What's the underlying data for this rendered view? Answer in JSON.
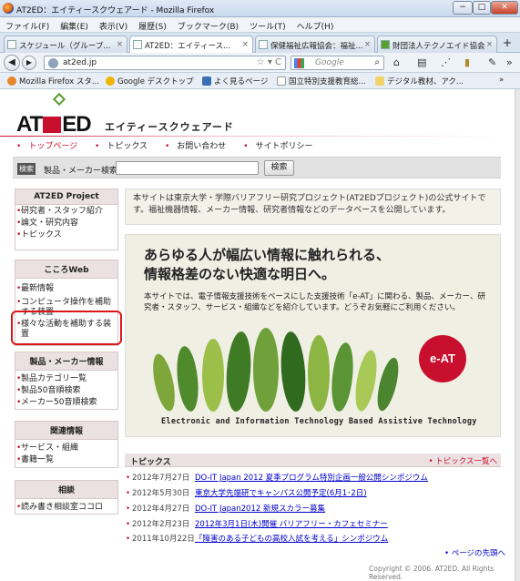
{
  "window": {
    "title": "AT2ED：エイティースクウェアード - Mozilla Firefox",
    "min": "−",
    "max": "□",
    "close": "✕"
  },
  "menu": [
    "ファイル(F)",
    "編集(E)",
    "表示(V)",
    "履歴(S)",
    "ブックマーク(B)",
    "ツール(T)",
    "ヘルプ(H)"
  ],
  "tabs": [
    {
      "label": "スケジュール（グループ..."
    },
    {
      "label": "AT2ED：エイティース..."
    },
    {
      "label": "保健福祉広報協会：福祉..."
    },
    {
      "label": "財団法人テクノエイド協会"
    }
  ],
  "new_tab": "+",
  "nav": {
    "url": "at2ed.jp",
    "search_placeholder": "Google"
  },
  "bookmarks": [
    "Mozilla Firefox スタ...",
    "Google デスクトップ",
    "よく見るページ",
    "国立特別支援教育総...",
    "デジタル教材、アク..."
  ],
  "site": {
    "logo_text_a": "AT",
    "logo_text_b": "ED",
    "logo_sub": "エイティースクウェアード",
    "topnav": [
      "トップページ",
      "トピックス",
      "お問い合わせ",
      "サイトポリシー"
    ],
    "search_label": "検索",
    "search_text": "製品・メーカー検索",
    "search_button": "検索"
  },
  "sidebar": [
    {
      "heading": "AT2ED Project",
      "items": [
        "研究者・スタッフ紹介",
        "論文・研究内容",
        "トピックス"
      ]
    },
    {
      "heading": "こころWeb",
      "items": [
        "最新情報",
        "コンピュータ操作を補助する装置",
        "様々な活動を補助する装置"
      ]
    },
    {
      "heading": "製品・メーカー情報",
      "items": [
        "製品カテゴリ一覧",
        "製品50音順検索",
        "メーカー50音順検索"
      ]
    },
    {
      "heading": "関連情報",
      "items": [
        "サービス・組織",
        "書籍一覧"
      ]
    },
    {
      "heading": "相談",
      "items": [
        "読み書き相談室ココロ"
      ]
    }
  ],
  "intro": "本サイトは東京大学・学際バリアフリー研究プロジェクト(AT2EDプロジェクト)の公式サイトです。福祉機器情報、メーカー情報、研究者情報などのデータベースを公開しています。",
  "hero": {
    "headline1": "あらゆる人が幅広い情報に触れられる、",
    "headline2": "情報格差のない快適な明日へ。",
    "body": "本サイトでは、電子情報支援技術をベースにした支援技術「e-AT」に関わる、製品、メーカー、研究者・スタッフ、サービス・組織などを紹介しています。どうぞお気軽にご利用ください。",
    "badge": "e-AT",
    "caption": "Electronic and Information Technology Based Assistive Technology"
  },
  "topics": {
    "heading": "トピックス",
    "list_link": "トピックス一覧へ",
    "rows": [
      {
        "date": "2012年7月27日",
        "text": "DO-IT Japan 2012 夏季プログラム特別企画一般公開シンポジウム"
      },
      {
        "date": "2012年5月30日",
        "text": "東京大学先端研でキャンパス公開予定(6月1･2日)"
      },
      {
        "date": "2012年4月27日",
        "text": "DO-IT Japan2012 新規スカラー募集"
      },
      {
        "date": "2012年2月23日",
        "text": "2012年3月1日(木)開催 バリアフリー・カフェセミナー"
      },
      {
        "date": "2011年10月22日",
        "text": "「障害のある子どもの高校入試を考える」シンポジウム"
      }
    ],
    "back_top": "ページの先頭へ"
  },
  "copyright": "Copyright © 2006. AT2ED. All Rights Reserved.",
  "colors": {
    "accent": "#c8102e",
    "annotation": "#d9161b"
  }
}
